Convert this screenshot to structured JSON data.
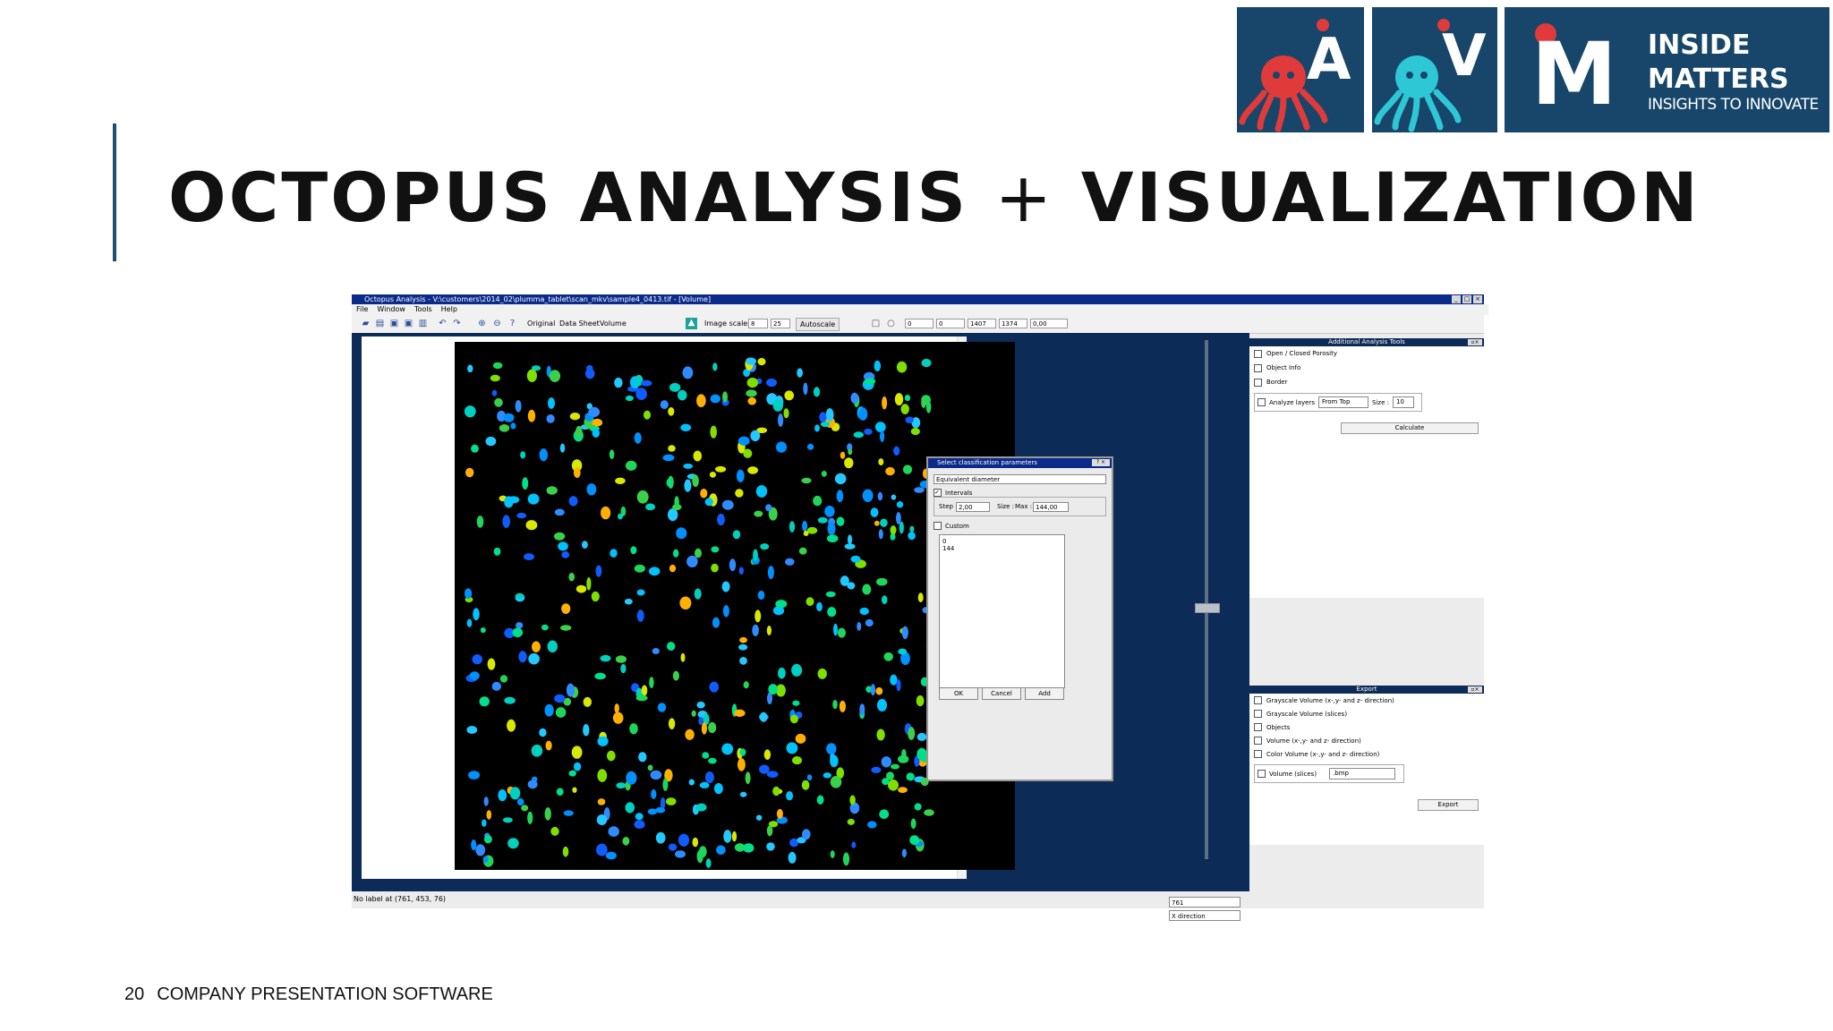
{
  "slide": {
    "title_main": "OCTOPUS ANALYSIS",
    "title_plus": "+",
    "title_end": "VISUALIZATION",
    "page_number": "20",
    "footer": "COMPANY PRESENTATION SOFTWARE"
  },
  "logos": {
    "a_letter": "A",
    "v_letter": "V",
    "m_letter": "M",
    "m_line1": "INSIDE",
    "m_line2": "MATTERS",
    "m_tagline": "INSIGHTS TO INNOVATE",
    "colors": {
      "background": "#17466a",
      "red_octopus": "#e03a3a",
      "cyan_octopus": "#2ec7d6"
    }
  },
  "app": {
    "title": "Octopus Analysis - V:\\customers\\2014_02\\plumma_tablet\\scan_mkv\\sample4_0413.tif - [Volume]",
    "menu": [
      "File",
      "Window",
      "Tools",
      "Help"
    ],
    "toolbar": {
      "original": "Original",
      "data_sheet": "Data Sheet",
      "volume": "Volume",
      "image_scales": "Image scales",
      "scale_min": "8",
      "scale_max": "25",
      "autoscale": "Autoscale",
      "crop_values": [
        "0",
        "0",
        "1407",
        "1374",
        "0,00"
      ]
    },
    "slice_value": "761",
    "direction": "X direction",
    "status": "No label at (761, 453, 76)"
  },
  "dialog": {
    "title": "Select classification parameters",
    "parameter": "Equivalent diameter",
    "intervals_label": "Intervals",
    "step_label": "Step :",
    "step_value": "2,00",
    "size_label": "Size :",
    "max_label": "Max :",
    "max_value": "144,00",
    "custom_label": "Custom",
    "list_values": [
      "0",
      "144"
    ],
    "ok": "OK",
    "cancel": "Cancel",
    "add": "Add"
  },
  "analysis_tools": {
    "title": "Additional Analysis Tools",
    "options": [
      "Open / Closed Porosity",
      "Object Info",
      "Border"
    ],
    "analyze_layers": "Analyze layers",
    "direction_value": "From Top",
    "size_label": "Size :",
    "size_value": "10",
    "calculate": "Calculate"
  },
  "export": {
    "title": "Export",
    "options": [
      "Grayscale Volume (x-,y- and z- direction)",
      "Grayscale Volume (slices)",
      "Objects",
      "Volume (x-,y- and z- direction)",
      "Color Volume (x-,y- and z- direction)"
    ],
    "volume_slices": "Volume (slices)",
    "format": ".bmp",
    "export_button": "Export"
  }
}
